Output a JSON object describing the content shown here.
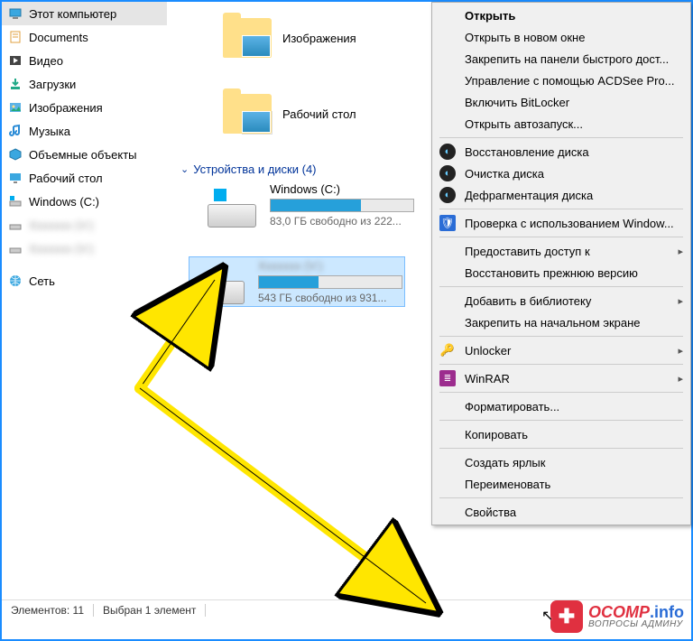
{
  "sidebar": {
    "items": [
      {
        "label": "Этот компьютер",
        "icon": "pc"
      },
      {
        "label": "Documents",
        "icon": "doc"
      },
      {
        "label": "Видео",
        "icon": "video"
      },
      {
        "label": "Загрузки",
        "icon": "download"
      },
      {
        "label": "Изображения",
        "icon": "pictures"
      },
      {
        "label": "Музыка",
        "icon": "music"
      },
      {
        "label": "Объемные объекты",
        "icon": "3d"
      },
      {
        "label": "Рабочий стол",
        "icon": "desktop"
      },
      {
        "label": "Windows (C:)",
        "icon": "drive-win"
      },
      {
        "label": "blurred (V:)",
        "icon": "drive",
        "blur": true,
        "suffix": "(V:)"
      },
      {
        "label": "blurred (V:)",
        "icon": "drive",
        "blur": true,
        "suffix": "(V:)"
      },
      {
        "label": "Сеть",
        "icon": "network"
      }
    ]
  },
  "main": {
    "folders": [
      {
        "label": "Изображения"
      },
      {
        "label": "Рабочий стол"
      }
    ],
    "group_header": "Устройства и диски (4)",
    "drives": [
      {
        "name": "Windows (C:)",
        "fill_pct": 63,
        "free": "83,0 ГБ свободно из 222...",
        "win": true
      },
      {
        "name": "blurred (V:)",
        "blur": true,
        "fill_pct": 42,
        "free": "543 ГБ свободно из 931...",
        "selected": true
      }
    ]
  },
  "status": {
    "count": "Элементов: 11",
    "selected": "Выбран 1 элемент"
  },
  "ctx": {
    "items": [
      {
        "label": "Открыть",
        "bold": true
      },
      {
        "label": "Открыть в новом окне"
      },
      {
        "label": "Закрепить на панели быстрого дост..."
      },
      {
        "label": "Управление с помощью ACDSee Pro..."
      },
      {
        "label": "Включить BitLocker"
      },
      {
        "label": "Открыть автозапуск..."
      },
      {
        "sep": true
      },
      {
        "label": "Восстановление диска",
        "icon": "circle"
      },
      {
        "label": "Очистка диска",
        "icon": "circle"
      },
      {
        "label": "Дефрагментация диска",
        "icon": "circle"
      },
      {
        "sep": true
      },
      {
        "label": "Проверка с использованием Window...",
        "icon": "shield"
      },
      {
        "sep": true
      },
      {
        "label": "Предоставить доступ к",
        "arrow": true
      },
      {
        "label": "Восстановить прежнюю версию"
      },
      {
        "sep": true
      },
      {
        "label": "Добавить в библиотеку",
        "arrow": true
      },
      {
        "label": "Закрепить на начальном экране"
      },
      {
        "sep": true
      },
      {
        "label": "Unlocker",
        "icon": "key",
        "arrow": true
      },
      {
        "sep": true
      },
      {
        "label": "WinRAR",
        "icon": "rar",
        "arrow": true
      },
      {
        "sep": true
      },
      {
        "label": "Форматировать..."
      },
      {
        "sep": true
      },
      {
        "label": "Копировать"
      },
      {
        "sep": true
      },
      {
        "label": "Создать ярлык"
      },
      {
        "label": "Переименовать"
      },
      {
        "sep": true
      },
      {
        "label": "Свойства"
      }
    ]
  },
  "watermark": {
    "main1": "OCOMP",
    "main2": ".info",
    "sub": "ВОПРОСЫ АДМИНУ"
  }
}
